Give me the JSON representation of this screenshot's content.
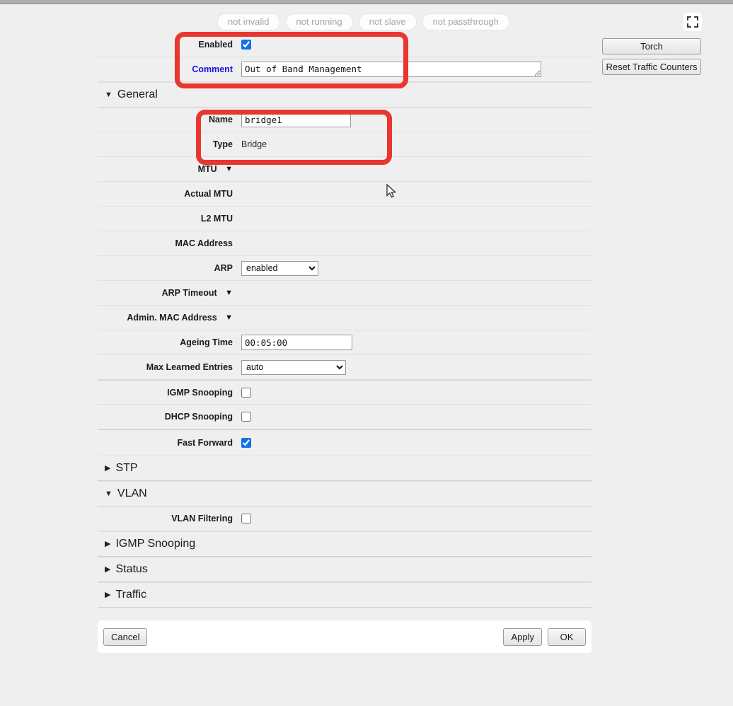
{
  "status_pills": [
    {
      "label": "not invalid"
    },
    {
      "label": "not running"
    },
    {
      "label": "not slave"
    },
    {
      "label": "not passthrough"
    }
  ],
  "side_buttons": {
    "torch": "Torch",
    "reset_traffic_counters": "Reset Traffic Counters"
  },
  "icons": {
    "fullscreen": "fullscreen-icon"
  },
  "top_fields": {
    "enabled_label": "Enabled",
    "enabled_checked": true,
    "comment_label": "Comment",
    "comment_value": "Out of Band Management"
  },
  "sections": {
    "general": {
      "title": "General",
      "expanded": true,
      "triangle": "▼"
    },
    "stp": {
      "title": "STP",
      "expanded": false,
      "triangle": "▶"
    },
    "vlan": {
      "title": "VLAN",
      "expanded": true,
      "triangle": "▼"
    },
    "igmp_snooping": {
      "title": "IGMP Snooping",
      "expanded": false,
      "triangle": "▶"
    },
    "status": {
      "title": "Status",
      "expanded": false,
      "triangle": "▶"
    },
    "traffic": {
      "title": "Traffic",
      "expanded": false,
      "triangle": "▶"
    }
  },
  "general_fields": {
    "name_label": "Name",
    "name_value": "bridge1",
    "type_label": "Type",
    "type_value": "Bridge",
    "mtu_label": "MTU",
    "mtu_triangle": "▼",
    "actual_mtu_label": "Actual MTU",
    "actual_mtu_value": "",
    "l2_mtu_label": "L2 MTU",
    "l2_mtu_value": "",
    "mac_address_label": "MAC Address",
    "mac_address_value": "",
    "arp_label": "ARP",
    "arp_value": "enabled",
    "arp_options": [
      "enabled"
    ],
    "arp_timeout_label": "ARP Timeout",
    "arp_timeout_triangle": "▼",
    "admin_mac_label": "Admin. MAC Address",
    "admin_mac_triangle": "▼",
    "ageing_time_label": "Ageing Time",
    "ageing_time_value": "00:05:00",
    "max_learned_entries_label": "Max Learned Entries",
    "max_learned_entries_value": "auto",
    "max_learned_entries_options": [
      "auto"
    ],
    "igmp_snooping_label": "IGMP Snooping",
    "igmp_snooping_checked": false,
    "dhcp_snooping_label": "DHCP Snooping",
    "dhcp_snooping_checked": false,
    "fast_forward_label": "Fast Forward",
    "fast_forward_checked": true
  },
  "vlan_fields": {
    "vlan_filtering_label": "VLAN Filtering",
    "vlan_filtering_checked": false
  },
  "footer": {
    "cancel": "Cancel",
    "apply": "Apply",
    "ok": "OK"
  },
  "colors": {
    "annotation_red": "#e8372f",
    "checkbox_blue": "#1271e8",
    "link_blue": "#1414e0",
    "page_background": "#efefef"
  }
}
